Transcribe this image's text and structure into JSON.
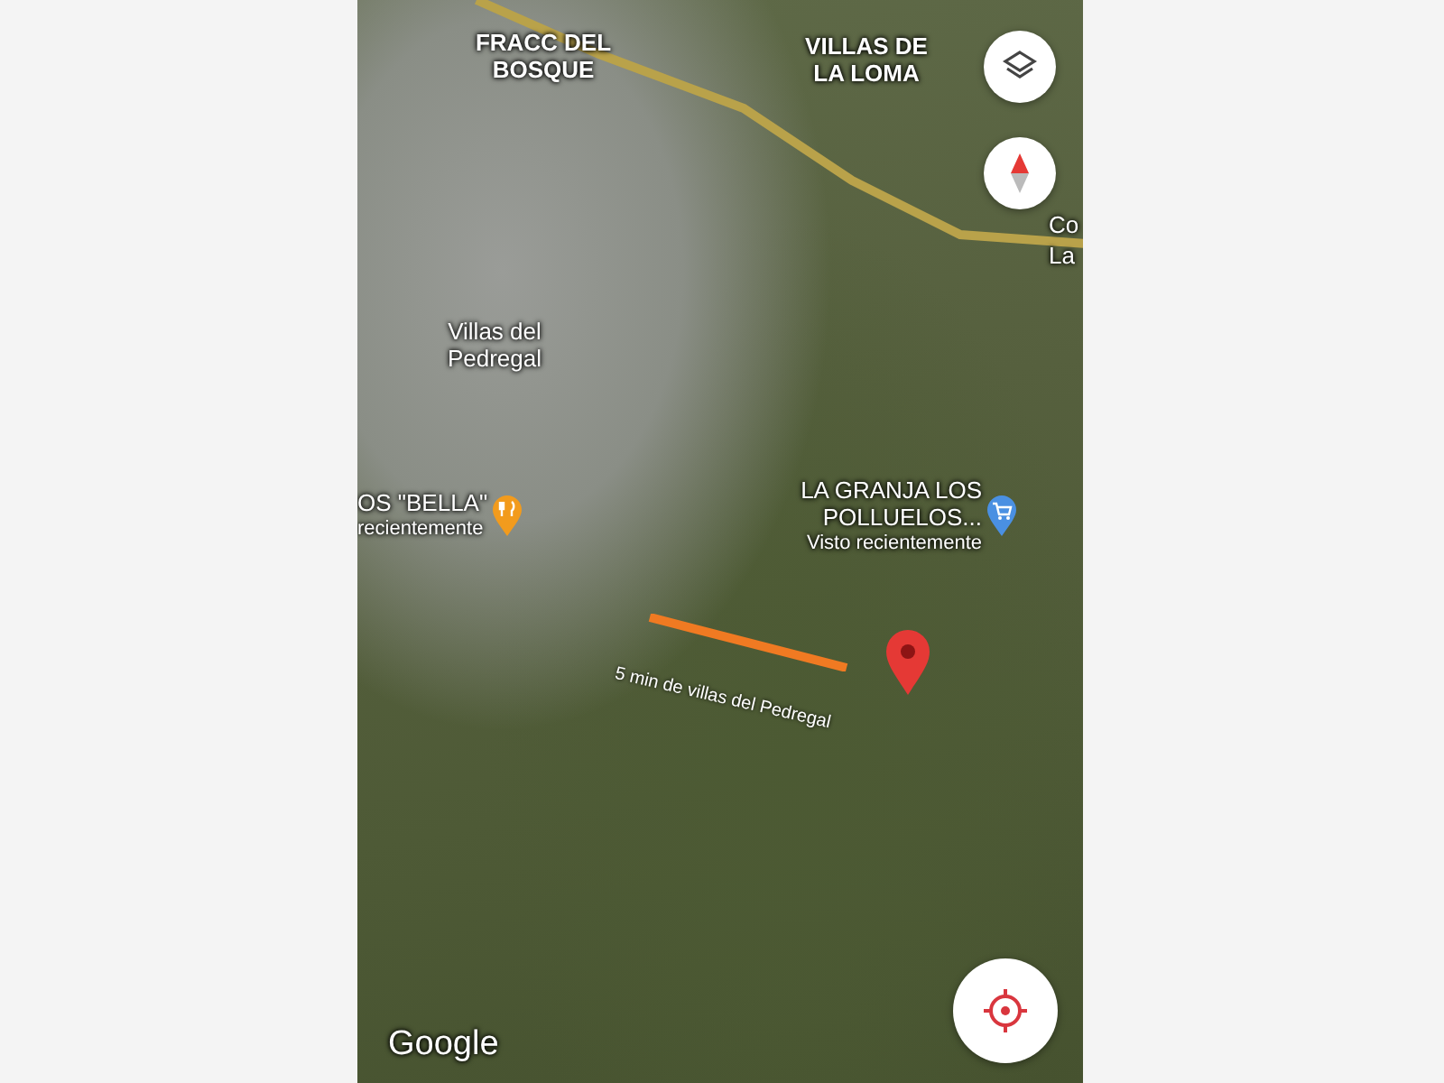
{
  "map": {
    "places": [
      {
        "name": "FRACC DEL\nBOSQUE",
        "kind": "district"
      },
      {
        "name": "VILLAS DE\nLA LOMA",
        "kind": "district"
      },
      {
        "name": "Villas del\nPedregal",
        "kind": "neighborhood"
      },
      {
        "name": "Co\nLa",
        "kind": "edge"
      }
    ],
    "pois": [
      {
        "name": "OS \"BELLA\"",
        "subtitle": "recientemente",
        "kind": "restaurant"
      },
      {
        "name": "LA GRANJA LOS\nPOLLUELOS...",
        "subtitle": "Visto recientemente",
        "kind": "shop"
      }
    ],
    "annotation": {
      "text": "5 min de villas del Pedregal"
    },
    "attribution": "Google"
  },
  "controls": [
    {
      "kind": "layers"
    },
    {
      "kind": "compass"
    },
    {
      "kind": "locate"
    }
  ]
}
